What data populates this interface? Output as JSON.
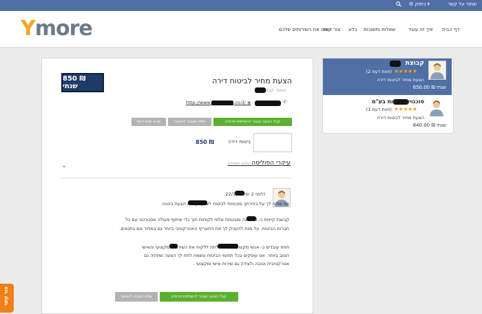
{
  "topbar": {
    "save_contact": "שמור על קשר",
    "logout": "ניתוק"
  },
  "logo": {
    "first": "Y",
    "rest": "more"
  },
  "nav": [
    "דף הבית",
    "איך זה עובד",
    "שאלות ותשובות",
    "בלוג",
    "צור קשר",
    "הציגו את השירותים שלכם"
  ],
  "offer": {
    "price_badge": "850 ₪ שנתי",
    "title": "הצעת מחיר לביטוח דירה",
    "from_prefix": "מאת: קבוצת",
    "website_prefix": "http://www.",
    "website_suffix": ".co.il/",
    "buttons": {
      "accept": "קבל הצעה ועבור להשלמת פרטים",
      "reply": "שלח תגובה להצעה",
      "read_more": "קרא חוות דעת"
    },
    "line_label": "ביטוח דירה",
    "line_price": "850 ₪",
    "policy_title": "עיקרי הפוליסה",
    "policy_hint": "(לחץ לצפייה)"
  },
  "message": {
    "date": "22/12 (לפני 2 ימים)",
    "lines": [
      "אני מודה לך על בחירתך סוכנויות לביטוח לצורך קבלת הצעת ביטוח.",
      "קבוצת קיימת כ- 50 שנה ומבטחת אלפי לקוחות תוך כדי שיתוף פעולה אסטרטגי עם כל",
      "חברות הביטוח. על מנת להעניק לך את התעריף האטרקטיבי ביותר גם במחיר וגם בתנאים.",
      "תחת עובדים כ- אנשי מקצוע על מנת לתת ללקוח את השירות המקצועי והאישי",
      "הטוב ביותר. אנו עוסקים בכל תחומי הביטוח ונשמח לתת לך הצעה שתהיה גם",
      "אטרקטיבית וטובה ולצידה גם שירות אישי ומקצועי ."
    ],
    "buttons": {
      "accept": "קבל הצעה ועבור להשלמת פרטים",
      "reply": "שלח תגובה להצעה"
    }
  },
  "sidebar": {
    "items": [
      {
        "name": "קבוצת",
        "reviews": "(2 חוות דעת)",
        "subtitle": "הצעת מחיר לביטוח דירה",
        "price": "850.00 ₪ שנתי",
        "stars": "★★★★★"
      },
      {
        "name": "סוכנויות ביטוח בע\"מ",
        "reviews": "(1 חוות דעת)",
        "subtitle": "הצעת מחיר לביטוח דירה",
        "price": "840.00 ₪ שנתי",
        "stars": "★★★★★"
      }
    ]
  },
  "side_tab": "צור קשר",
  "colors": {
    "topbar": "#4f6fa5",
    "accent_orange": "#f5a623",
    "green": "#5cb02f",
    "navy": "#1e3a66"
  }
}
